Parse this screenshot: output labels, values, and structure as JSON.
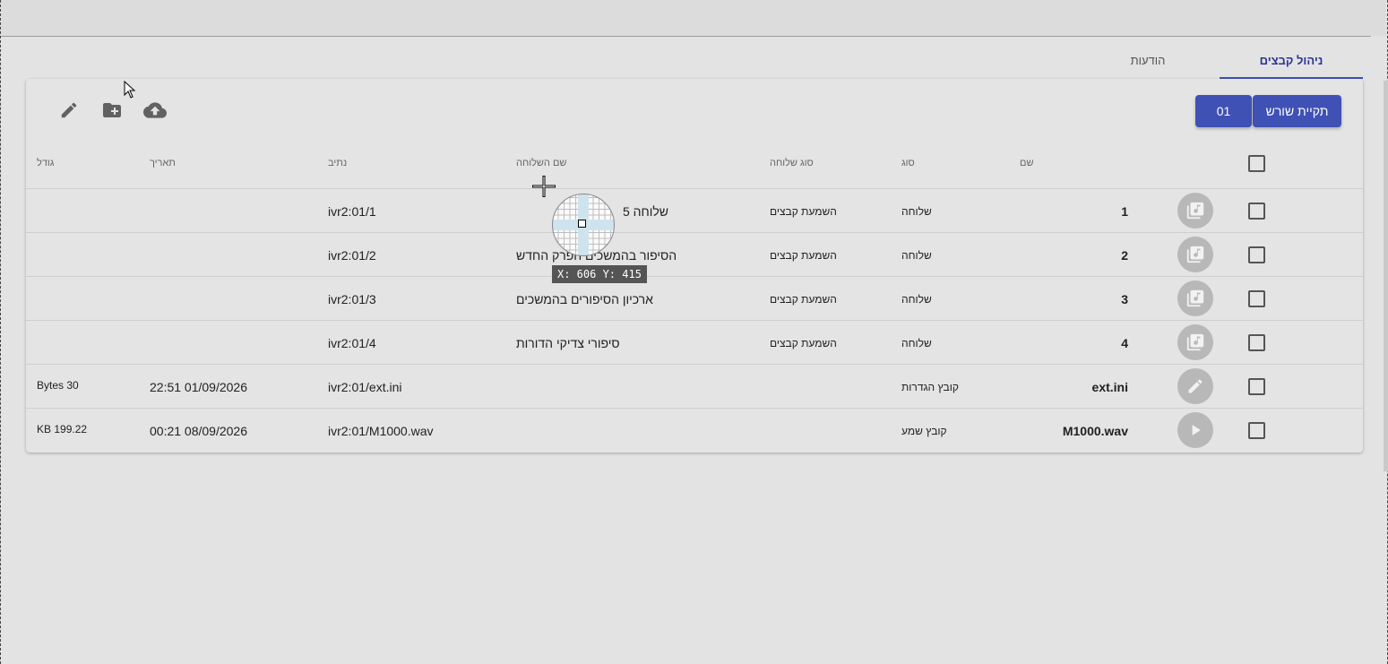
{
  "tabs": [
    {
      "label": "ניהול קבצים",
      "active": true
    },
    {
      "label": "הודעות",
      "active": false
    }
  ],
  "toolbar": {
    "root_button": "תקיית שורש",
    "folder_button": "01",
    "icons": [
      "upload-icon",
      "add-folder-icon",
      "edit-icon"
    ]
  },
  "table": {
    "columns": {
      "name": "שם",
      "type": "סוג",
      "ext_type": "סוג שלוחה",
      "ext_name": "שם השלוחה",
      "path": "נתיב",
      "date": "תאריך",
      "size": "גודל"
    },
    "rows": [
      {
        "name": "1",
        "type": "שלוחה",
        "ext_type": "השמעת קבצים",
        "ext_name": "שלוחה 5",
        "path": "ivr2:01/1",
        "date": "",
        "size": "",
        "icon": "music-library-icon"
      },
      {
        "name": "2",
        "type": "שלוחה",
        "ext_type": "השמעת קבצים",
        "ext_name": "הסיפור בהמשכים הפרק החדש",
        "path": "ivr2:01/2",
        "date": "",
        "size": "",
        "icon": "music-library-icon"
      },
      {
        "name": "3",
        "type": "שלוחה",
        "ext_type": "השמעת קבצים",
        "ext_name": "ארכיון הסיפורים בהמשכים",
        "path": "ivr2:01/3",
        "date": "",
        "size": "",
        "icon": "music-library-icon"
      },
      {
        "name": "4",
        "type": "שלוחה",
        "ext_type": "השמעת קבצים",
        "ext_name": "סיפורי צדיקי הדורות",
        "path": "ivr2:01/4",
        "date": "",
        "size": "",
        "icon": "music-library-icon"
      },
      {
        "name": "ext.ini",
        "type": "קובץ הגדרות",
        "ext_type": "",
        "ext_name": "",
        "path": "ivr2:01/ext.ini",
        "date": "22:51 01/09/2026",
        "size": "Bytes 30",
        "icon": "edit-icon"
      },
      {
        "name": "M1000.wav",
        "type": "קובץ שמע",
        "ext_type": "",
        "ext_name": "",
        "path": "ivr2:01/M1000.wav",
        "date": "00:21 08/09/2026",
        "size": "KB 199.22",
        "icon": "play-icon"
      }
    ]
  },
  "overlay": {
    "coordinates": "X: 606 Y: 415"
  },
  "colors": {
    "accent": "#3f51b5",
    "background": "#e3e3e3",
    "avatar": "#b8b8b8"
  }
}
